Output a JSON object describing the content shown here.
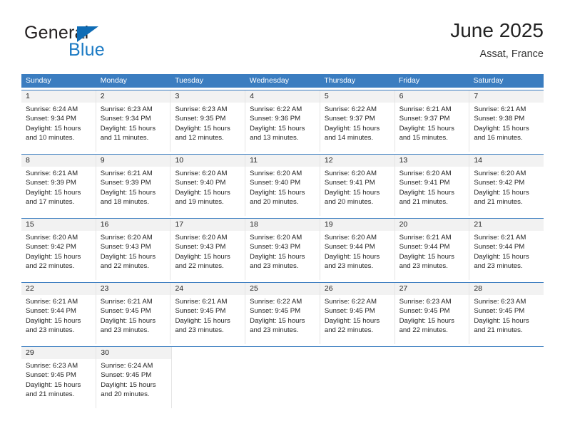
{
  "brand": {
    "name_part1": "General",
    "name_part2": "Blue",
    "accent_color": "#1b7ac4",
    "triangle_color": "#0f6cb5"
  },
  "header": {
    "title": "June 2025",
    "subtitle": "Assat, France"
  },
  "calendar": {
    "header_bg": "#3b7dc0",
    "weekdays": [
      "Sunday",
      "Monday",
      "Tuesday",
      "Wednesday",
      "Thursday",
      "Friday",
      "Saturday"
    ],
    "labels": {
      "sunrise": "Sunrise:",
      "sunset": "Sunset:",
      "daylight": "Daylight:"
    },
    "weeks": [
      {
        "days": [
          {
            "num": "1",
            "sunrise": "Sunrise: 6:24 AM",
            "sunset": "Sunset: 9:34 PM",
            "daylight_line1": "Daylight: 15 hours",
            "daylight_line2": "and 10 minutes."
          },
          {
            "num": "2",
            "sunrise": "Sunrise: 6:23 AM",
            "sunset": "Sunset: 9:34 PM",
            "daylight_line1": "Daylight: 15 hours",
            "daylight_line2": "and 11 minutes."
          },
          {
            "num": "3",
            "sunrise": "Sunrise: 6:23 AM",
            "sunset": "Sunset: 9:35 PM",
            "daylight_line1": "Daylight: 15 hours",
            "daylight_line2": "and 12 minutes."
          },
          {
            "num": "4",
            "sunrise": "Sunrise: 6:22 AM",
            "sunset": "Sunset: 9:36 PM",
            "daylight_line1": "Daylight: 15 hours",
            "daylight_line2": "and 13 minutes."
          },
          {
            "num": "5",
            "sunrise": "Sunrise: 6:22 AM",
            "sunset": "Sunset: 9:37 PM",
            "daylight_line1": "Daylight: 15 hours",
            "daylight_line2": "and 14 minutes."
          },
          {
            "num": "6",
            "sunrise": "Sunrise: 6:21 AM",
            "sunset": "Sunset: 9:37 PM",
            "daylight_line1": "Daylight: 15 hours",
            "daylight_line2": "and 15 minutes."
          },
          {
            "num": "7",
            "sunrise": "Sunrise: 6:21 AM",
            "sunset": "Sunset: 9:38 PM",
            "daylight_line1": "Daylight: 15 hours",
            "daylight_line2": "and 16 minutes."
          }
        ]
      },
      {
        "days": [
          {
            "num": "8",
            "sunrise": "Sunrise: 6:21 AM",
            "sunset": "Sunset: 9:39 PM",
            "daylight_line1": "Daylight: 15 hours",
            "daylight_line2": "and 17 minutes."
          },
          {
            "num": "9",
            "sunrise": "Sunrise: 6:21 AM",
            "sunset": "Sunset: 9:39 PM",
            "daylight_line1": "Daylight: 15 hours",
            "daylight_line2": "and 18 minutes."
          },
          {
            "num": "10",
            "sunrise": "Sunrise: 6:20 AM",
            "sunset": "Sunset: 9:40 PM",
            "daylight_line1": "Daylight: 15 hours",
            "daylight_line2": "and 19 minutes."
          },
          {
            "num": "11",
            "sunrise": "Sunrise: 6:20 AM",
            "sunset": "Sunset: 9:40 PM",
            "daylight_line1": "Daylight: 15 hours",
            "daylight_line2": "and 20 minutes."
          },
          {
            "num": "12",
            "sunrise": "Sunrise: 6:20 AM",
            "sunset": "Sunset: 9:41 PM",
            "daylight_line1": "Daylight: 15 hours",
            "daylight_line2": "and 20 minutes."
          },
          {
            "num": "13",
            "sunrise": "Sunrise: 6:20 AM",
            "sunset": "Sunset: 9:41 PM",
            "daylight_line1": "Daylight: 15 hours",
            "daylight_line2": "and 21 minutes."
          },
          {
            "num": "14",
            "sunrise": "Sunrise: 6:20 AM",
            "sunset": "Sunset: 9:42 PM",
            "daylight_line1": "Daylight: 15 hours",
            "daylight_line2": "and 21 minutes."
          }
        ]
      },
      {
        "days": [
          {
            "num": "15",
            "sunrise": "Sunrise: 6:20 AM",
            "sunset": "Sunset: 9:42 PM",
            "daylight_line1": "Daylight: 15 hours",
            "daylight_line2": "and 22 minutes."
          },
          {
            "num": "16",
            "sunrise": "Sunrise: 6:20 AM",
            "sunset": "Sunset: 9:43 PM",
            "daylight_line1": "Daylight: 15 hours",
            "daylight_line2": "and 22 minutes."
          },
          {
            "num": "17",
            "sunrise": "Sunrise: 6:20 AM",
            "sunset": "Sunset: 9:43 PM",
            "daylight_line1": "Daylight: 15 hours",
            "daylight_line2": "and 22 minutes."
          },
          {
            "num": "18",
            "sunrise": "Sunrise: 6:20 AM",
            "sunset": "Sunset: 9:43 PM",
            "daylight_line1": "Daylight: 15 hours",
            "daylight_line2": "and 23 minutes."
          },
          {
            "num": "19",
            "sunrise": "Sunrise: 6:20 AM",
            "sunset": "Sunset: 9:44 PM",
            "daylight_line1": "Daylight: 15 hours",
            "daylight_line2": "and 23 minutes."
          },
          {
            "num": "20",
            "sunrise": "Sunrise: 6:21 AM",
            "sunset": "Sunset: 9:44 PM",
            "daylight_line1": "Daylight: 15 hours",
            "daylight_line2": "and 23 minutes."
          },
          {
            "num": "21",
            "sunrise": "Sunrise: 6:21 AM",
            "sunset": "Sunset: 9:44 PM",
            "daylight_line1": "Daylight: 15 hours",
            "daylight_line2": "and 23 minutes."
          }
        ]
      },
      {
        "days": [
          {
            "num": "22",
            "sunrise": "Sunrise: 6:21 AM",
            "sunset": "Sunset: 9:44 PM",
            "daylight_line1": "Daylight: 15 hours",
            "daylight_line2": "and 23 minutes."
          },
          {
            "num": "23",
            "sunrise": "Sunrise: 6:21 AM",
            "sunset": "Sunset: 9:45 PM",
            "daylight_line1": "Daylight: 15 hours",
            "daylight_line2": "and 23 minutes."
          },
          {
            "num": "24",
            "sunrise": "Sunrise: 6:21 AM",
            "sunset": "Sunset: 9:45 PM",
            "daylight_line1": "Daylight: 15 hours",
            "daylight_line2": "and 23 minutes."
          },
          {
            "num": "25",
            "sunrise": "Sunrise: 6:22 AM",
            "sunset": "Sunset: 9:45 PM",
            "daylight_line1": "Daylight: 15 hours",
            "daylight_line2": "and 23 minutes."
          },
          {
            "num": "26",
            "sunrise": "Sunrise: 6:22 AM",
            "sunset": "Sunset: 9:45 PM",
            "daylight_line1": "Daylight: 15 hours",
            "daylight_line2": "and 22 minutes."
          },
          {
            "num": "27",
            "sunrise": "Sunrise: 6:23 AM",
            "sunset": "Sunset: 9:45 PM",
            "daylight_line1": "Daylight: 15 hours",
            "daylight_line2": "and 22 minutes."
          },
          {
            "num": "28",
            "sunrise": "Sunrise: 6:23 AM",
            "sunset": "Sunset: 9:45 PM",
            "daylight_line1": "Daylight: 15 hours",
            "daylight_line2": "and 21 minutes."
          }
        ]
      },
      {
        "days": [
          {
            "num": "29",
            "sunrise": "Sunrise: 6:23 AM",
            "sunset": "Sunset: 9:45 PM",
            "daylight_line1": "Daylight: 15 hours",
            "daylight_line2": "and 21 minutes."
          },
          {
            "num": "30",
            "sunrise": "Sunrise: 6:24 AM",
            "sunset": "Sunset: 9:45 PM",
            "daylight_line1": "Daylight: 15 hours",
            "daylight_line2": "and 20 minutes."
          },
          {
            "num": "",
            "sunrise": "",
            "sunset": "",
            "daylight_line1": "",
            "daylight_line2": ""
          },
          {
            "num": "",
            "sunrise": "",
            "sunset": "",
            "daylight_line1": "",
            "daylight_line2": ""
          },
          {
            "num": "",
            "sunrise": "",
            "sunset": "",
            "daylight_line1": "",
            "daylight_line2": ""
          },
          {
            "num": "",
            "sunrise": "",
            "sunset": "",
            "daylight_line1": "",
            "daylight_line2": ""
          },
          {
            "num": "",
            "sunrise": "",
            "sunset": "",
            "daylight_line1": "",
            "daylight_line2": ""
          }
        ]
      }
    ]
  }
}
